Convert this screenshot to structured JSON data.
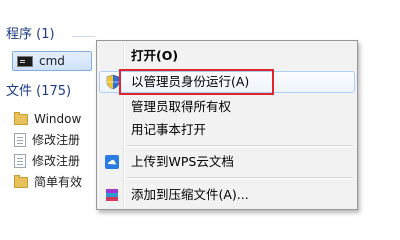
{
  "programs": {
    "header": "程序 (1)",
    "items": [
      {
        "label": "cmd",
        "icon": "cmd-icon"
      }
    ]
  },
  "files": {
    "header": "文件 (175)",
    "items": [
      {
        "label": "Window",
        "icon": "folder-icon"
      },
      {
        "label": "修改注册",
        "icon": "doc-icon"
      },
      {
        "label": "修改注册",
        "icon": "doc-icon"
      },
      {
        "label": "简单有效",
        "icon": "folder-icon"
      }
    ]
  },
  "context_menu": {
    "open": "打开(O)",
    "run_as_admin": "以管理员身份运行(A)",
    "take_ownership": "管理员取得所有权",
    "open_notepad": "用记事本打开",
    "upload_wps": "上传到WPS云文档",
    "add_archive": "添加到压缩文件(A)..."
  },
  "colors": {
    "highlight_box": "#e0262b",
    "group_header": "#1e3a8a",
    "selection_border": "#84acdd"
  }
}
